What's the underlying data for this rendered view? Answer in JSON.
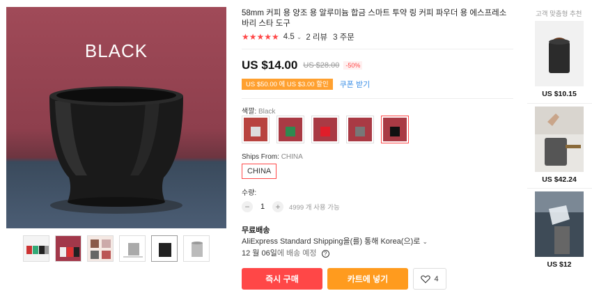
{
  "main_image": {
    "label": "BLACK"
  },
  "thumbnails": [
    "thumb-1",
    "thumb-2",
    "thumb-3",
    "thumb-4",
    "thumb-5",
    "thumb-6"
  ],
  "product": {
    "title": "58mm 커피 용 양조 용 알루미늄 합금 스마트 투약 링 커피 파우더 용 에스프레소 바리 스타 도구",
    "stars": "★★★★★",
    "rating": "4.5",
    "rating_caret": "⌄",
    "reviews": "2 리뷰",
    "orders": "3 주문"
  },
  "price": {
    "current": "US $14.00",
    "original": "US $28.00",
    "discount": "-50%"
  },
  "coupon": {
    "tag": "US $50.00 에 US $3.00 할인",
    "link": "쿠폰 받기"
  },
  "color": {
    "label": "색깔:",
    "value": "Black",
    "options": [
      "silver",
      "green",
      "red",
      "titanium",
      "black"
    ],
    "selected": "black"
  },
  "ships_from": {
    "label": "Ships From:",
    "value": "CHINA",
    "option": "CHINA"
  },
  "quantity": {
    "label": "수량:",
    "minus": "−",
    "value": "1",
    "plus": "+",
    "available": "4999 개 사용 가능"
  },
  "shipping": {
    "title": "무료배송",
    "line1": "AliExpress Standard Shipping을(를) 통해 Korea(으)로",
    "line1_caret": "⌄",
    "date": "12 월 06일",
    "date_suffix": "에 배송 예정",
    "help": "?"
  },
  "actions": {
    "buy_now": "즉시 구매",
    "add_to_cart": "카트에 넣기",
    "wishlist_count": "4"
  },
  "recommendations": {
    "header": "고객 맞춤형 추천",
    "items": [
      {
        "price": "US $10.15"
      },
      {
        "price": "US $42.24"
      },
      {
        "price": "US $12"
      }
    ]
  },
  "colors": {
    "accent_red": "#ff4747",
    "accent_orange": "#ff9b1e",
    "coupon_orange": "#ffa02f",
    "link_blue": "#3a8ee6"
  }
}
